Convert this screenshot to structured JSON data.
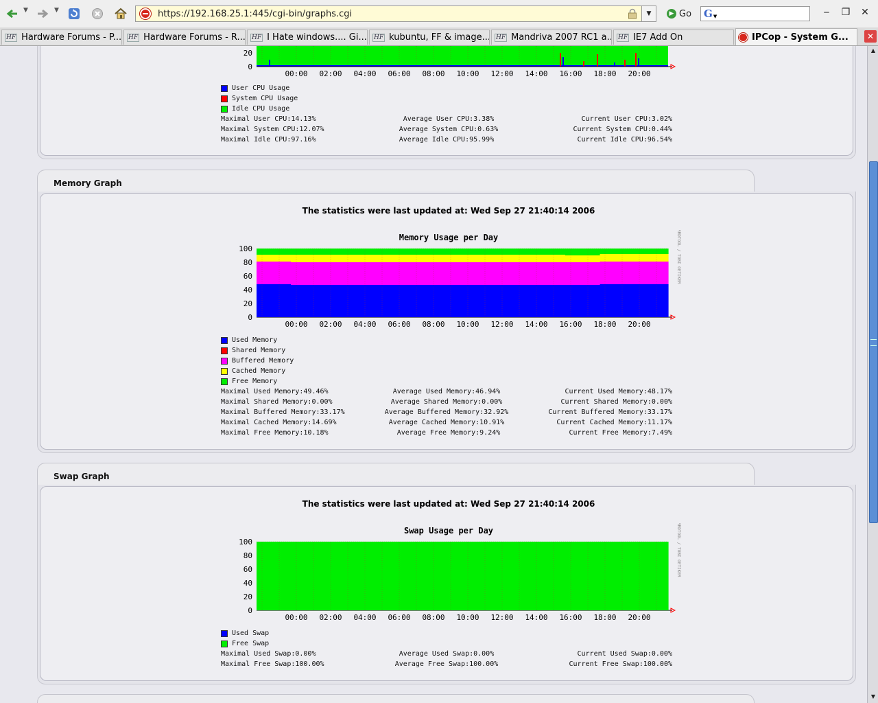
{
  "browser": {
    "url": "https://192.168.25.1:445/cgi-bin/graphs.cgi",
    "go_label": "Go",
    "search_engine_glyph": "G",
    "tabs": [
      {
        "label": "Hardware Forums - P...",
        "favicon": "HF"
      },
      {
        "label": "Hardware Forums - R...",
        "favicon": "HF"
      },
      {
        "label": "I Hate windows.... Gi...",
        "favicon": "HF"
      },
      {
        "label": "kubuntu, FF & image...",
        "favicon": "HF"
      },
      {
        "label": "Mandriva 2007 RC1 a...",
        "favicon": "HF"
      },
      {
        "label": "IE7 Add On",
        "favicon": "HF"
      },
      {
        "label": "IPCop - System G...",
        "favicon": "ipcop-icon"
      }
    ]
  },
  "colors": {
    "used": "#0000ff",
    "shared": "#ff0000",
    "buffered": "#ff00ff",
    "cached": "#ffff00",
    "free": "#00ee00",
    "user_cpu": "#0000ff",
    "system_cpu": "#ff0000",
    "idle_cpu": "#00ee00"
  },
  "cpu": {
    "legend": [
      "User CPU Usage",
      "System CPU Usage",
      "Idle CPU Usage"
    ],
    "stats": [
      [
        "Maximal User CPU:14.13%",
        "Average User CPU:3.38%",
        "Current User CPU:3.02%"
      ],
      [
        "Maximal System CPU:12.07%",
        "Average System CPU:0.63%",
        "Current System CPU:0.44%"
      ],
      [
        "Maximal Idle CPU:97.16%",
        "Average Idle CPU:95.99%",
        "Current Idle CPU:96.54%"
      ]
    ]
  },
  "memory": {
    "section_title": "Memory Graph",
    "updated": "The statistics were last updated at: Wed Sep 27 21:40:14 2006",
    "legend": [
      "Used Memory",
      "Shared Memory",
      "Buffered Memory",
      "Cached Memory",
      "Free Memory"
    ],
    "stats": [
      [
        "Maximal Used Memory:49.46%",
        "Average Used Memory:46.94%",
        "Current Used Memory:48.17%"
      ],
      [
        "Maximal Shared Memory:0.00%",
        "Average Shared Memory:0.00%",
        "Current Shared Memory:0.00%"
      ],
      [
        "Maximal Buffered Memory:33.17%",
        "Average Buffered Memory:32.92%",
        "Current Buffered Memory:33.17%"
      ],
      [
        "Maximal Cached Memory:14.69%",
        "Average Cached Memory:10.91%",
        "Current Cached Memory:11.17%"
      ],
      [
        "Maximal Free Memory:10.18%",
        "Average Free Memory:9.24%",
        "Current Free Memory:7.49%"
      ]
    ]
  },
  "swap": {
    "section_title": "Swap Graph",
    "updated": "The statistics were last updated at: Wed Sep 27 21:40:14 2006",
    "legend": [
      "Used Swap",
      "Free Swap"
    ],
    "stats": [
      [
        "Maximal Used Swap:0.00%",
        "Average Used Swap:0.00%",
        "Current Used Swap:0.00%"
      ],
      [
        "Maximal Free Swap:100.00%",
        "Average Free Swap:100.00%",
        "Current Free Swap:100.00%"
      ]
    ]
  },
  "chart_data": [
    {
      "type": "area",
      "title": "",
      "x_ticks": [
        "00:00",
        "02:00",
        "04:00",
        "06:00",
        "08:00",
        "10:00",
        "12:00",
        "14:00",
        "16:00",
        "18:00",
        "20:00"
      ],
      "y_ticks": [
        0,
        20
      ],
      "series": [
        {
          "name": "User CPU Usage",
          "description": "low usage ~3%, spikes near 23:00, 16:30-21:40"
        },
        {
          "name": "System CPU Usage",
          "description": "low ~0.6%, spikes up to ~12% near 17:00 and 21:00"
        },
        {
          "name": "Idle CPU Usage",
          "description": "remainder ~96%"
        }
      ]
    },
    {
      "type": "area",
      "title": "Memory Usage per Day",
      "x_ticks": [
        "00:00",
        "02:00",
        "04:00",
        "06:00",
        "08:00",
        "10:00",
        "12:00",
        "14:00",
        "16:00",
        "18:00",
        "20:00"
      ],
      "y_ticks": [
        0,
        20,
        40,
        60,
        80,
        100
      ],
      "ylim": [
        0,
        100
      ],
      "watermark": "RRDTOOL / TOBI OETIKER",
      "series": [
        {
          "name": "Used Memory",
          "values": [
            48,
            47,
            47,
            47,
            47,
            47,
            47,
            47,
            47,
            47,
            48,
            48
          ]
        },
        {
          "name": "Shared Memory",
          "values": [
            0,
            0,
            0,
            0,
            0,
            0,
            0,
            0,
            0,
            0,
            0,
            0
          ]
        },
        {
          "name": "Buffered Memory",
          "values": [
            33,
            33,
            33,
            33,
            33,
            33,
            33,
            33,
            33,
            33,
            33,
            33
          ]
        },
        {
          "name": "Cached Memory",
          "values": [
            10,
            11,
            11,
            11,
            11,
            11,
            11,
            11,
            11,
            10,
            11,
            11
          ]
        },
        {
          "name": "Free Memory",
          "values": [
            9,
            9,
            9,
            9,
            9,
            9,
            9,
            9,
            9,
            10,
            8,
            8
          ]
        }
      ]
    },
    {
      "type": "area",
      "title": "Swap Usage per Day",
      "x_ticks": [
        "00:00",
        "02:00",
        "04:00",
        "06:00",
        "08:00",
        "10:00",
        "12:00",
        "14:00",
        "16:00",
        "18:00",
        "20:00"
      ],
      "y_ticks": [
        0,
        20,
        40,
        60,
        80,
        100
      ],
      "ylim": [
        0,
        100
      ],
      "watermark": "RRDTOOL / TOBI OETIKER",
      "series": [
        {
          "name": "Used Swap",
          "values": [
            0,
            0,
            0,
            0,
            0,
            0,
            0,
            0,
            0,
            0,
            0,
            0
          ]
        },
        {
          "name": "Free Swap",
          "values": [
            100,
            100,
            100,
            100,
            100,
            100,
            100,
            100,
            100,
            100,
            100,
            100
          ]
        }
      ]
    }
  ]
}
